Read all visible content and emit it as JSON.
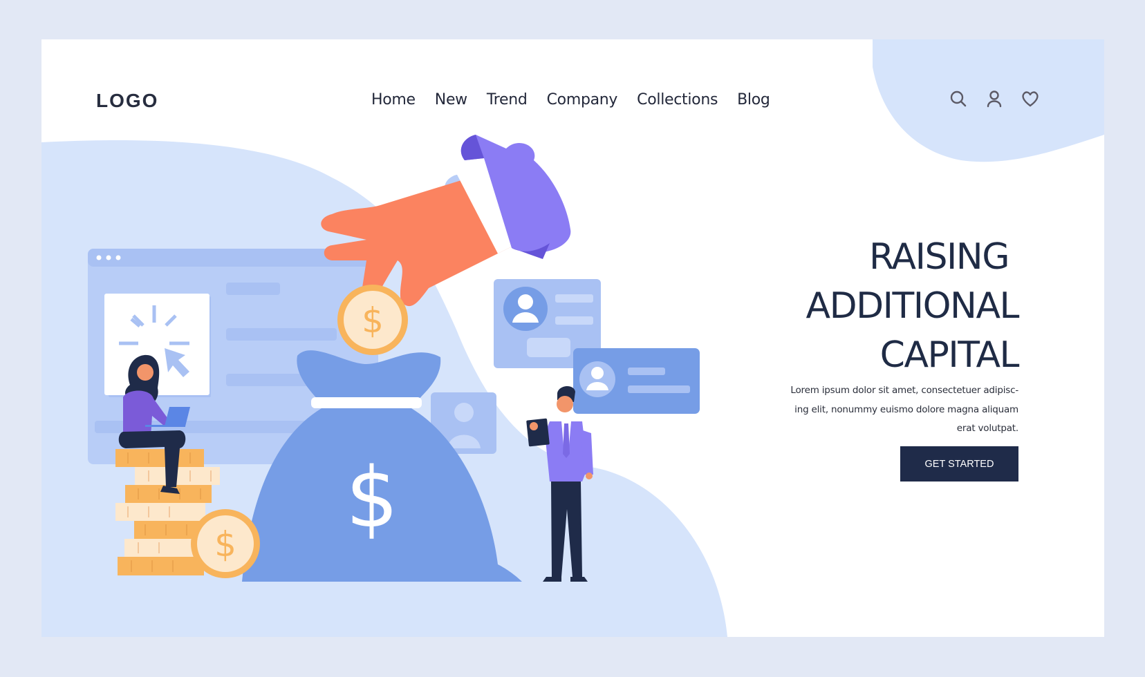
{
  "header": {
    "logo": "LOGO",
    "nav": [
      {
        "label": "Home"
      },
      {
        "label": "New"
      },
      {
        "label": "Trend"
      },
      {
        "label": "Company"
      },
      {
        "label": "Collections"
      },
      {
        "label": "Blog"
      }
    ],
    "icons": [
      "search-icon",
      "user-icon",
      "heart-icon"
    ]
  },
  "hero": {
    "title_lines": [
      "RAISING",
      "ADDITIONAL",
      "CAPITAL"
    ],
    "body_lines": [
      "Lorem ipsum dolor sit amet, consectetuer adipisc-",
      "ing elit, nonummy euismo dolore magna aliquam",
      "erat volutpat."
    ],
    "cta_label": "GET STARTED"
  },
  "illustration": {
    "currency_symbol": "$",
    "colors": {
      "page_bg": "#e2e8f5",
      "blob": "#d6e4fb",
      "window": "#b8cdf7",
      "bag": "#769de6",
      "coin": "#f8b45c",
      "coin_face": "#fde8cc",
      "hand": "#fb8360",
      "sleeve": "#8b7cf4",
      "navy": "#1f2b49"
    }
  }
}
